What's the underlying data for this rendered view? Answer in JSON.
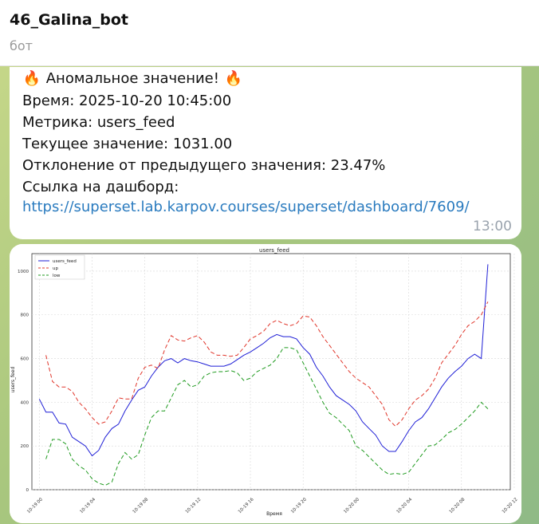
{
  "header": {
    "title": "46_Galina_bot",
    "subtitle": "бот"
  },
  "message": {
    "icon": "fire-icon",
    "headline": "Аномальное значение!",
    "time_line": "Время: 2025-10-20 10:45:00",
    "metric_line": "Метрика: users_feed",
    "current_line": "Текущее значение: 1031.00",
    "deviation_line": "Отклонение от предыдущего значения: 23.47%",
    "dashboard_label": "Ссылка на дашборд:",
    "dashboard_link": "https://superset.lab.karpov.courses/superset/dashboard/7609/",
    "timestamp": "13:00"
  },
  "chart_data": {
    "type": "line",
    "title": "users_feed",
    "xlabel": "Время",
    "ylabel": "users_feed",
    "ylim": [
      0,
      1080
    ],
    "y_ticks": [
      0,
      200,
      400,
      600,
      800,
      1000
    ],
    "x_ticks": [
      "10-19 00",
      "10-19 04",
      "10-19 08",
      "10-19 12",
      "10-19 16",
      "10-19 20",
      "10-20 00",
      "10-20 04",
      "10-20 08",
      "10-20 12"
    ],
    "grid": true,
    "legend": "top-left",
    "series": [
      {
        "name": "users_feed",
        "color": "#1f1fd6",
        "dash": "solid",
        "points": [
          [
            0,
            415
          ],
          [
            0.5,
            355
          ],
          [
            1,
            355
          ],
          [
            1.5,
            305
          ],
          [
            2,
            300
          ],
          [
            2.5,
            240
          ],
          [
            3,
            220
          ],
          [
            3.5,
            200
          ],
          [
            4,
            155
          ],
          [
            4.5,
            180
          ],
          [
            5,
            240
          ],
          [
            5.5,
            280
          ],
          [
            6,
            300
          ],
          [
            6.5,
            360
          ],
          [
            7,
            410
          ],
          [
            7.5,
            455
          ],
          [
            8,
            470
          ],
          [
            8.5,
            520
          ],
          [
            9,
            560
          ],
          [
            9.5,
            590
          ],
          [
            10,
            600
          ],
          [
            10.5,
            580
          ],
          [
            11,
            600
          ],
          [
            11.5,
            590
          ],
          [
            12,
            585
          ],
          [
            12.5,
            575
          ],
          [
            13,
            565
          ],
          [
            13.5,
            565
          ],
          [
            14,
            565
          ],
          [
            14.5,
            575
          ],
          [
            15,
            595
          ],
          [
            15.5,
            615
          ],
          [
            16,
            630
          ],
          [
            16.5,
            650
          ],
          [
            17,
            670
          ],
          [
            17.5,
            695
          ],
          [
            18,
            710
          ],
          [
            18.5,
            700
          ],
          [
            19,
            700
          ],
          [
            19.5,
            690
          ],
          [
            20,
            650
          ],
          [
            20.5,
            620
          ],
          [
            21,
            560
          ],
          [
            21.5,
            520
          ],
          [
            22,
            470
          ],
          [
            22.5,
            430
          ],
          [
            23,
            410
          ],
          [
            23.5,
            390
          ],
          [
            24,
            360
          ],
          [
            24.5,
            310
          ],
          [
            25,
            280
          ],
          [
            25.5,
            250
          ],
          [
            26,
            200
          ],
          [
            26.5,
            175
          ],
          [
            27,
            175
          ],
          [
            27.5,
            220
          ],
          [
            28,
            270
          ],
          [
            28.5,
            310
          ],
          [
            29,
            330
          ],
          [
            29.5,
            370
          ],
          [
            30,
            420
          ],
          [
            30.5,
            470
          ],
          [
            31,
            510
          ],
          [
            31.5,
            540
          ],
          [
            32,
            565
          ],
          [
            32.5,
            600
          ],
          [
            33,
            620
          ],
          [
            33.5,
            600
          ],
          [
            34,
            1031
          ]
        ]
      },
      {
        "name": "up",
        "color": "#e0352a",
        "dash": "5,3",
        "points": [
          [
            0.5,
            615
          ],
          [
            1,
            495
          ],
          [
            1.5,
            470
          ],
          [
            2,
            470
          ],
          [
            2.5,
            450
          ],
          [
            3,
            400
          ],
          [
            3.5,
            370
          ],
          [
            4,
            330
          ],
          [
            4.5,
            300
          ],
          [
            5,
            310
          ],
          [
            5.5,
            360
          ],
          [
            6,
            420
          ],
          [
            6.5,
            415
          ],
          [
            7,
            415
          ],
          [
            7.5,
            510
          ],
          [
            8,
            560
          ],
          [
            8.5,
            570
          ],
          [
            9,
            555
          ],
          [
            9.5,
            640
          ],
          [
            10,
            705
          ],
          [
            10.5,
            685
          ],
          [
            11,
            680
          ],
          [
            11.5,
            695
          ],
          [
            12,
            705
          ],
          [
            12.5,
            675
          ],
          [
            13,
            630
          ],
          [
            13.5,
            615
          ],
          [
            14,
            615
          ],
          [
            14.5,
            610
          ],
          [
            15,
            615
          ],
          [
            15.5,
            650
          ],
          [
            16,
            690
          ],
          [
            16.5,
            705
          ],
          [
            17,
            725
          ],
          [
            17.5,
            760
          ],
          [
            18,
            775
          ],
          [
            18.5,
            760
          ],
          [
            19,
            750
          ],
          [
            19.5,
            760
          ],
          [
            20,
            795
          ],
          [
            20.5,
            790
          ],
          [
            21,
            750
          ],
          [
            21.5,
            700
          ],
          [
            22,
            660
          ],
          [
            22.5,
            620
          ],
          [
            23,
            580
          ],
          [
            23.5,
            540
          ],
          [
            24,
            510
          ],
          [
            24.5,
            490
          ],
          [
            25,
            470
          ],
          [
            25.5,
            430
          ],
          [
            26,
            390
          ],
          [
            26.5,
            320
          ],
          [
            27,
            290
          ],
          [
            27.5,
            320
          ],
          [
            28,
            370
          ],
          [
            28.5,
            410
          ],
          [
            29,
            430
          ],
          [
            29.5,
            460
          ],
          [
            30,
            510
          ],
          [
            30.5,
            580
          ],
          [
            31,
            620
          ],
          [
            31.5,
            660
          ],
          [
            32,
            710
          ],
          [
            32.5,
            750
          ],
          [
            33,
            770
          ],
          [
            33.5,
            800
          ],
          [
            34,
            860
          ]
        ]
      },
      {
        "name": "low",
        "color": "#1e9a1e",
        "dash": "5,3",
        "points": [
          [
            0.5,
            140
          ],
          [
            1,
            230
          ],
          [
            1.5,
            230
          ],
          [
            2,
            210
          ],
          [
            2.5,
            140
          ],
          [
            3,
            110
          ],
          [
            3.5,
            90
          ],
          [
            4,
            50
          ],
          [
            4.5,
            30
          ],
          [
            5,
            20
          ],
          [
            5.5,
            35
          ],
          [
            6,
            120
          ],
          [
            6.5,
            170
          ],
          [
            7,
            140
          ],
          [
            7.5,
            160
          ],
          [
            8,
            250
          ],
          [
            8.5,
            330
          ],
          [
            9,
            360
          ],
          [
            9.5,
            360
          ],
          [
            10,
            420
          ],
          [
            10.5,
            480
          ],
          [
            11,
            500
          ],
          [
            11.5,
            470
          ],
          [
            12,
            480
          ],
          [
            12.5,
            520
          ],
          [
            13,
            535
          ],
          [
            13.5,
            540
          ],
          [
            14,
            540
          ],
          [
            14.5,
            545
          ],
          [
            15,
            535
          ],
          [
            15.5,
            500
          ],
          [
            16,
            510
          ],
          [
            16.5,
            540
          ],
          [
            17,
            555
          ],
          [
            17.5,
            570
          ],
          [
            18,
            600
          ],
          [
            18.5,
            650
          ],
          [
            19,
            650
          ],
          [
            19.5,
            640
          ],
          [
            20,
            580
          ],
          [
            20.5,
            520
          ],
          [
            21,
            460
          ],
          [
            21.5,
            400
          ],
          [
            22,
            350
          ],
          [
            22.5,
            330
          ],
          [
            23,
            300
          ],
          [
            23.5,
            270
          ],
          [
            24,
            200
          ],
          [
            24.5,
            180
          ],
          [
            25,
            150
          ],
          [
            25.5,
            120
          ],
          [
            26,
            90
          ],
          [
            26.5,
            70
          ],
          [
            27,
            75
          ],
          [
            27.5,
            70
          ],
          [
            28,
            80
          ],
          [
            28.5,
            120
          ],
          [
            29,
            160
          ],
          [
            29.5,
            200
          ],
          [
            30,
            205
          ],
          [
            30.5,
            230
          ],
          [
            31,
            260
          ],
          [
            31.5,
            275
          ],
          [
            32,
            300
          ],
          [
            32.5,
            330
          ],
          [
            33,
            360
          ],
          [
            33.5,
            400
          ],
          [
            34,
            370
          ]
        ]
      }
    ]
  }
}
